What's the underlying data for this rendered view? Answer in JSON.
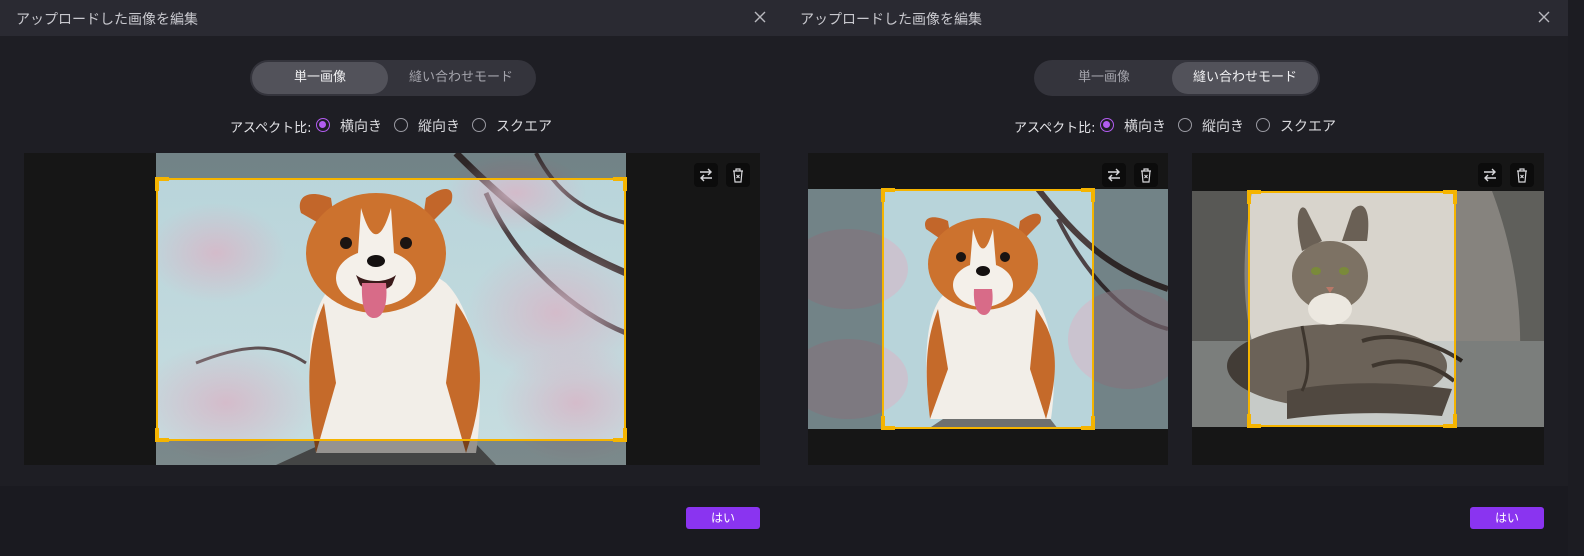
{
  "dialogs": [
    {
      "title": "アップロードした画像を編集",
      "modes": [
        {
          "label": "単一画像",
          "active": true
        },
        {
          "label": "縫い合わせモード",
          "active": false
        }
      ],
      "aspect_label": "アスペクト比:",
      "aspect_options": [
        {
          "label": "横向き",
          "checked": true
        },
        {
          "label": "縦向き",
          "checked": false
        },
        {
          "label": "スクエア",
          "checked": false
        }
      ],
      "ok_label": "はい"
    },
    {
      "title": "アップロードした画像を編集",
      "modes": [
        {
          "label": "単一画像",
          "active": false
        },
        {
          "label": "縫い合わせモード",
          "active": true
        }
      ],
      "aspect_label": "アスペクト比:",
      "aspect_options": [
        {
          "label": "横向き",
          "checked": true
        },
        {
          "label": "縦向き",
          "checked": false
        },
        {
          "label": "スクエア",
          "checked": false
        }
      ],
      "ok_label": "はい"
    }
  ],
  "icons": {
    "close": "close-icon",
    "swap": "swap-icon",
    "delete": "trash-icon"
  },
  "colors": {
    "crop_frame": "#f5b400",
    "radio_accent": "#b25cf0",
    "ok_button": "#8a34f0"
  }
}
